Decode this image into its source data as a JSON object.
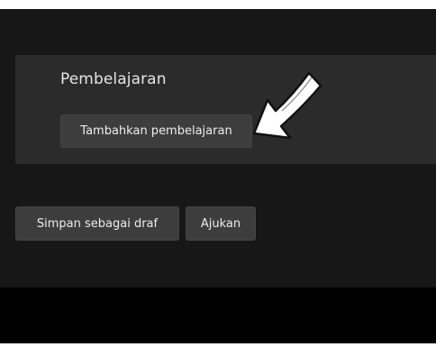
{
  "section": {
    "title": "Pembelajaran",
    "add_label": "Tambahkan pembelajaran"
  },
  "actions": {
    "draft_label": "Simpan sebagai draf",
    "submit_label": "Ajukan"
  },
  "annotation": {
    "icon": "arrow-pointer-icon",
    "color": "#ffffff"
  }
}
